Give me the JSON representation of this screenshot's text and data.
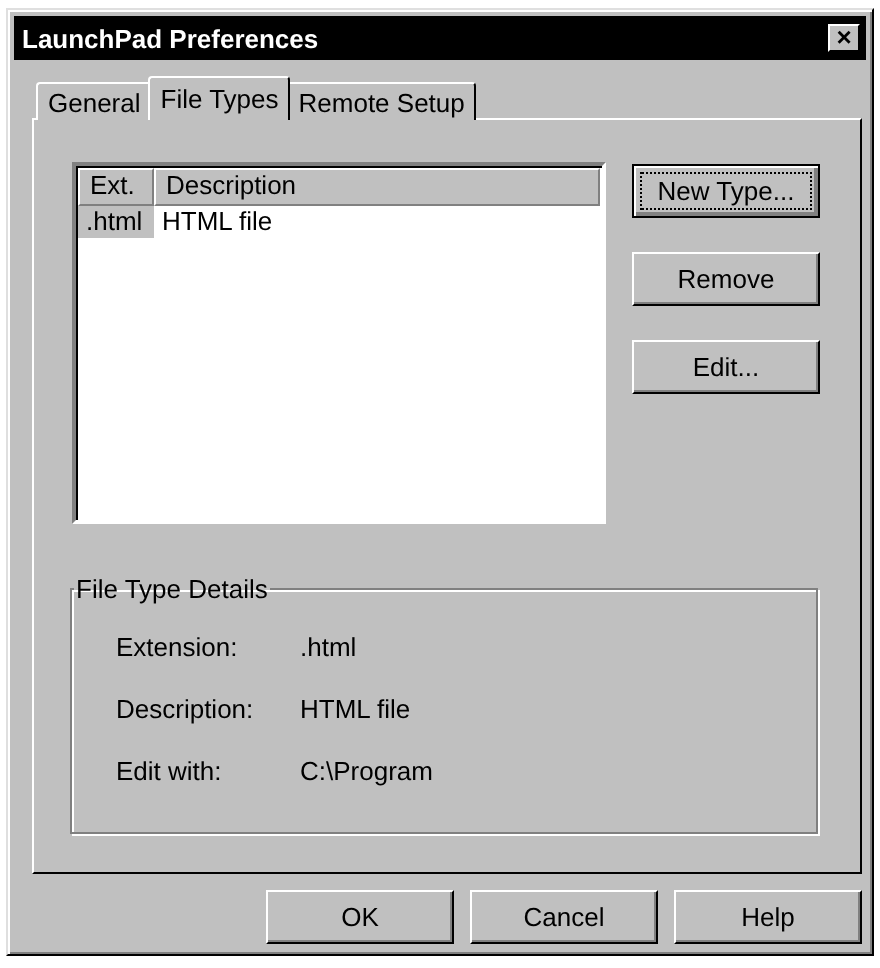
{
  "window": {
    "title": "LaunchPad Preferences",
    "close": "×"
  },
  "tabs": [
    {
      "label": "General",
      "selected": false
    },
    {
      "label": "File Types",
      "selected": true
    },
    {
      "label": "Remote Setup",
      "selected": false
    }
  ],
  "list": {
    "columns": [
      "Ext.",
      "Description"
    ],
    "rows": [
      {
        "ext": ".html",
        "description": "HTML file",
        "selected": true
      }
    ]
  },
  "side_buttons": [
    {
      "label": "New Type...",
      "focused": true
    },
    {
      "label": "Remove",
      "focused": false
    },
    {
      "label": "Edit...",
      "focused": false
    }
  ],
  "details": {
    "title": "File Type Details",
    "fields": [
      {
        "label": "Extension:",
        "value": ".html"
      },
      {
        "label": "Description:",
        "value": "HTML file"
      },
      {
        "label": "Edit with:",
        "value": "C:\\Program"
      }
    ]
  },
  "buttons": [
    "OK",
    "Cancel",
    "Help"
  ]
}
